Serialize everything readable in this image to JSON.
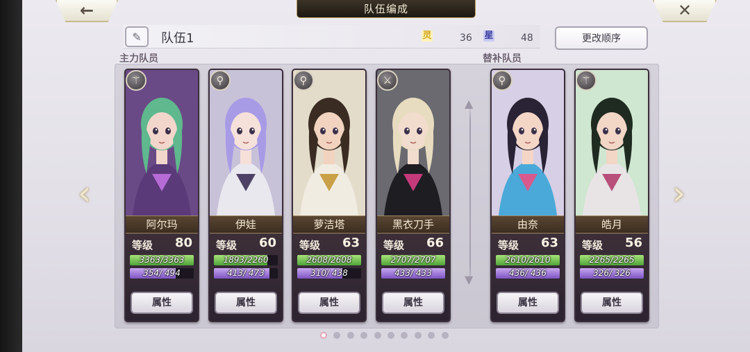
{
  "header": {
    "title": "队伍编成",
    "back_icon": "←",
    "close_icon": "✕"
  },
  "team": {
    "name": "队伍1",
    "stat_a": {
      "icon": "灵",
      "value": "36",
      "color": "#d3a51c"
    },
    "stat_b": {
      "icon": "星",
      "value": "48",
      "color": "#3b3d9e"
    },
    "order_button": "更改顺序"
  },
  "sections": {
    "main_label": "主力队员",
    "sub_label": "替补队员"
  },
  "members": [
    {
      "name": "阿尔玛",
      "level_label": "等级",
      "level": "80",
      "hp": "3363/3363",
      "hp_ratio": 1.0,
      "mp": "354/ 494",
      "mp_ratio": 0.717,
      "attr_button": "属性",
      "weapon": "staff",
      "weapon_glyph": "⚚"
    },
    {
      "name": "伊娃",
      "level_label": "等级",
      "level": "60",
      "hp": "1893/2260",
      "hp_ratio": 0.838,
      "mp": "413/ 473",
      "mp_ratio": 0.873,
      "attr_button": "属性",
      "weapon": "wand",
      "weapon_glyph": "⚲"
    },
    {
      "name": "萝洁塔",
      "level_label": "等级",
      "level": "63",
      "hp": "2608/2608",
      "hp_ratio": 1.0,
      "mp": "310/ 438",
      "mp_ratio": 0.708,
      "attr_button": "属性",
      "weapon": "wand",
      "weapon_glyph": "⚲"
    },
    {
      "name": "黑衣刀手",
      "level_label": "等级",
      "level": "66",
      "hp": "2707/2707",
      "hp_ratio": 1.0,
      "mp": "433/ 433",
      "mp_ratio": 1.0,
      "attr_button": "属性",
      "weapon": "sword",
      "weapon_glyph": "⚔"
    },
    {
      "name": "由奈",
      "level_label": "等级",
      "level": "63",
      "hp": "2610/2610",
      "hp_ratio": 1.0,
      "mp": "436/ 436",
      "mp_ratio": 1.0,
      "attr_button": "属性",
      "weapon": "wand",
      "weapon_glyph": "⚲"
    },
    {
      "name": "皓月",
      "level_label": "等级",
      "level": "56",
      "hp": "2265/2265",
      "hp_ratio": 1.0,
      "mp": "326/ 326",
      "mp_ratio": 1.0,
      "attr_button": "属性",
      "weapon": "staff",
      "weapon_glyph": "⚚"
    }
  ],
  "nav": {
    "left_arrow": "‹",
    "right_arrow": "›"
  },
  "pager": {
    "current": 1,
    "total": 10
  }
}
